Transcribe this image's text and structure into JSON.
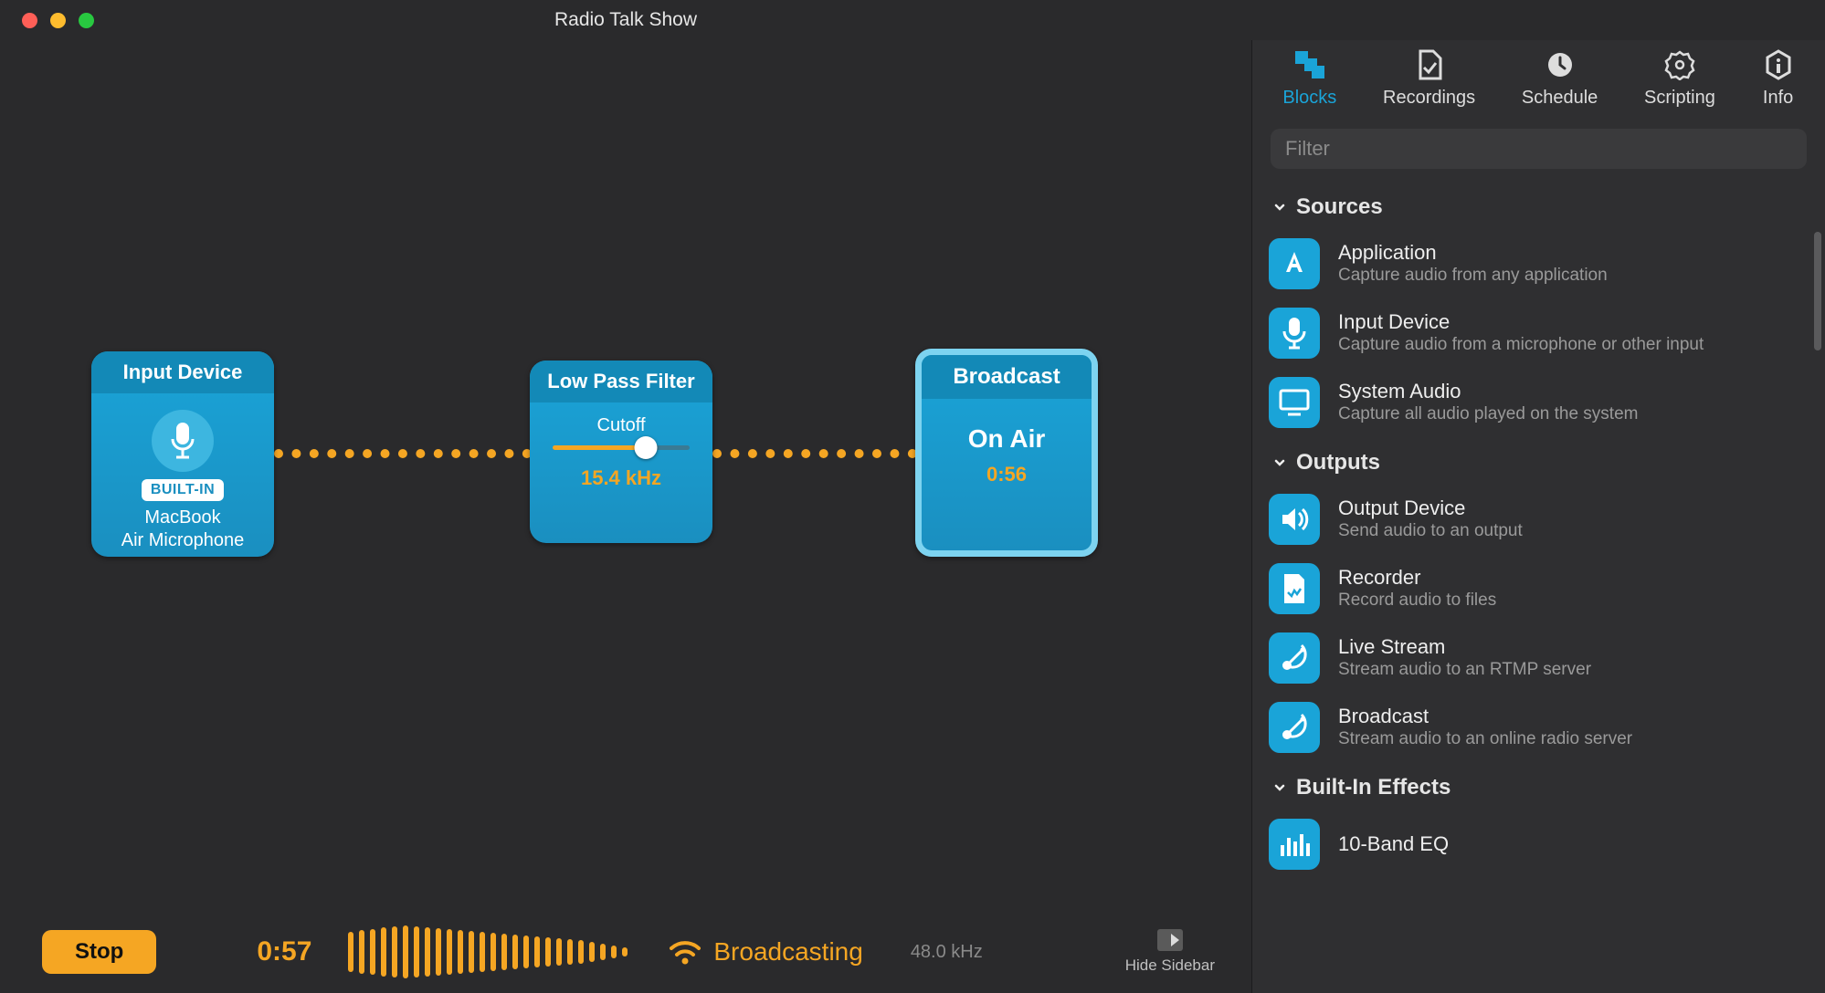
{
  "window": {
    "title": "Radio Talk Show"
  },
  "canvas": {
    "input": {
      "header": "Input Device",
      "badge": "BUILT-IN",
      "device": "MacBook\nAir Microphone"
    },
    "filter": {
      "header": "Low Pass Filter",
      "param_label": "Cutoff",
      "value": "15.4 kHz",
      "slider_pct": 68
    },
    "broadcast": {
      "header": "Broadcast",
      "status": "On Air",
      "time": "0:56"
    }
  },
  "footer": {
    "stop": "Stop",
    "elapsed": "0:57",
    "status": "Broadcasting",
    "samplerate": "48.0 kHz",
    "hide_sidebar": "Hide Sidebar",
    "waveform_bars": [
      44,
      48,
      50,
      54,
      56,
      58,
      56,
      54,
      52,
      50,
      48,
      46,
      44,
      42,
      40,
      38,
      36,
      34,
      32,
      30,
      28,
      26,
      22,
      18,
      14,
      10
    ]
  },
  "sidebar": {
    "tabs": [
      {
        "label": "Blocks",
        "active": true,
        "icon": "blocks"
      },
      {
        "label": "Recordings",
        "active": false,
        "icon": "recordings"
      },
      {
        "label": "Schedule",
        "active": false,
        "icon": "clock"
      },
      {
        "label": "Scripting",
        "active": false,
        "icon": "gear"
      },
      {
        "label": "Info",
        "active": false,
        "icon": "info"
      }
    ],
    "filter_placeholder": "Filter",
    "sections": [
      {
        "title": "Sources",
        "items": [
          {
            "title": "Application",
            "sub": "Capture audio from any application",
            "icon": "app"
          },
          {
            "title": "Input Device",
            "sub": "Capture audio from a microphone or other input",
            "icon": "mic"
          },
          {
            "title": "System Audio",
            "sub": "Capture all audio played on the system",
            "icon": "screen"
          }
        ]
      },
      {
        "title": "Outputs",
        "items": [
          {
            "title": "Output Device",
            "sub": "Send audio to an output",
            "icon": "speaker"
          },
          {
            "title": "Recorder",
            "sub": "Record audio to files",
            "icon": "file"
          },
          {
            "title": "Live Stream",
            "sub": "Stream audio to an RTMP server",
            "icon": "dish"
          },
          {
            "title": "Broadcast",
            "sub": "Stream audio to an online radio server",
            "icon": "dish"
          }
        ]
      },
      {
        "title": "Built-In Effects",
        "items": [
          {
            "title": "10-Band EQ",
            "sub": "",
            "icon": "eq"
          }
        ]
      }
    ]
  },
  "colors": {
    "accent": "#f5a623",
    "block": "#1aa4d8",
    "bg": "#2a2a2c"
  }
}
